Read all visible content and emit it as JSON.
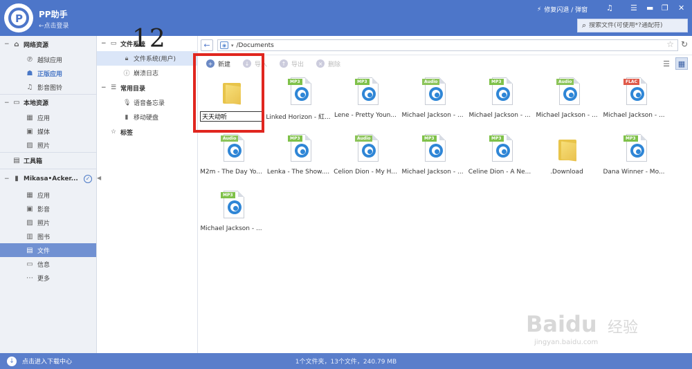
{
  "titlebar": {
    "app_title": "PP助手",
    "login_link": "←点击登录",
    "crash_fix": "修复闪退 / 弹窗",
    "search_placeholder": "搜索文件(可使用*?通配符)"
  },
  "sidebar": {
    "network": {
      "label": "网络资源",
      "items": [
        {
          "label": "越狱应用",
          "icon": "p-icon"
        },
        {
          "label": "正版应用",
          "icon": "store-icon"
        },
        {
          "label": "影音图铃",
          "icon": "music-icon"
        }
      ]
    },
    "local": {
      "label": "本地资源",
      "items": [
        {
          "label": "应用",
          "icon": "grid-icon"
        },
        {
          "label": "媒体",
          "icon": "media-icon"
        },
        {
          "label": "照片",
          "icon": "photo-icon"
        }
      ]
    },
    "toolbox": {
      "label": "工具箱"
    },
    "device": {
      "label": "Mikasa•Acker...",
      "items": [
        {
          "label": "应用",
          "icon": "grid-icon"
        },
        {
          "label": "影音",
          "icon": "media-icon"
        },
        {
          "label": "照片",
          "icon": "photo-icon"
        },
        {
          "label": "图书",
          "icon": "book-icon"
        },
        {
          "label": "文件",
          "icon": "file-icon"
        },
        {
          "label": "信息",
          "icon": "message-icon"
        },
        {
          "label": "更多",
          "icon": "more-icon"
        }
      ]
    }
  },
  "tree": {
    "filesystem": {
      "label": "文件系统",
      "items": [
        {
          "label": "文件系统(用户)"
        },
        {
          "label": "崩溃日志"
        }
      ]
    },
    "common": {
      "label": "常用目录",
      "items": [
        {
          "label": "语音备忘录"
        },
        {
          "label": "移动硬盘"
        }
      ]
    },
    "tags": {
      "label": "标签"
    }
  },
  "address": {
    "path": "/Documents"
  },
  "toolbar": {
    "new": "新建",
    "import": "导入",
    "export": "导出",
    "delete": "删除"
  },
  "files": [
    {
      "name": "天天动听",
      "type": "folder",
      "renaming": true
    },
    {
      "name": "Linked Horizon - 紅...",
      "type": "MP3"
    },
    {
      "name": "Lene - Pretty Youn...",
      "type": "MP3"
    },
    {
      "name": "Michael Jackson - ...",
      "type": "Audio"
    },
    {
      "name": "Michael Jackson - ...",
      "type": "MP3"
    },
    {
      "name": "Michael Jackson - ...",
      "type": "Audio"
    },
    {
      "name": "Michael Jackson - ...",
      "type": "FLAC"
    },
    {
      "name": "M2m - The Day Yo...",
      "type": "Audio"
    },
    {
      "name": "Lenka - The Show....",
      "type": "MP3"
    },
    {
      "name": "Celion Dion - My H...",
      "type": "Audio"
    },
    {
      "name": "Michael Jackson - ...",
      "type": "MP3"
    },
    {
      "name": "Celine Dion - A Ne...",
      "type": "MP3"
    },
    {
      "name": ".Download",
      "type": "folder"
    },
    {
      "name": "Dana Winner - Mo...",
      "type": "MP3"
    },
    {
      "name": "Michael Jackson - ...",
      "type": "MP3"
    }
  ],
  "annotation": {
    "number": "12",
    "color": "#e0261f"
  },
  "statusbar": {
    "download": "点击进入下载中心",
    "summary": "1个文件夹，13个文件，240.79 MB"
  },
  "watermark": {
    "logo": "Baidu",
    "cn": "经验",
    "url": "jingyan.baidu.com"
  },
  "colors": {
    "titlebar": "#4d76c9",
    "sidebar_active": "#7191d2",
    "statusbar": "#5a7ecb"
  }
}
